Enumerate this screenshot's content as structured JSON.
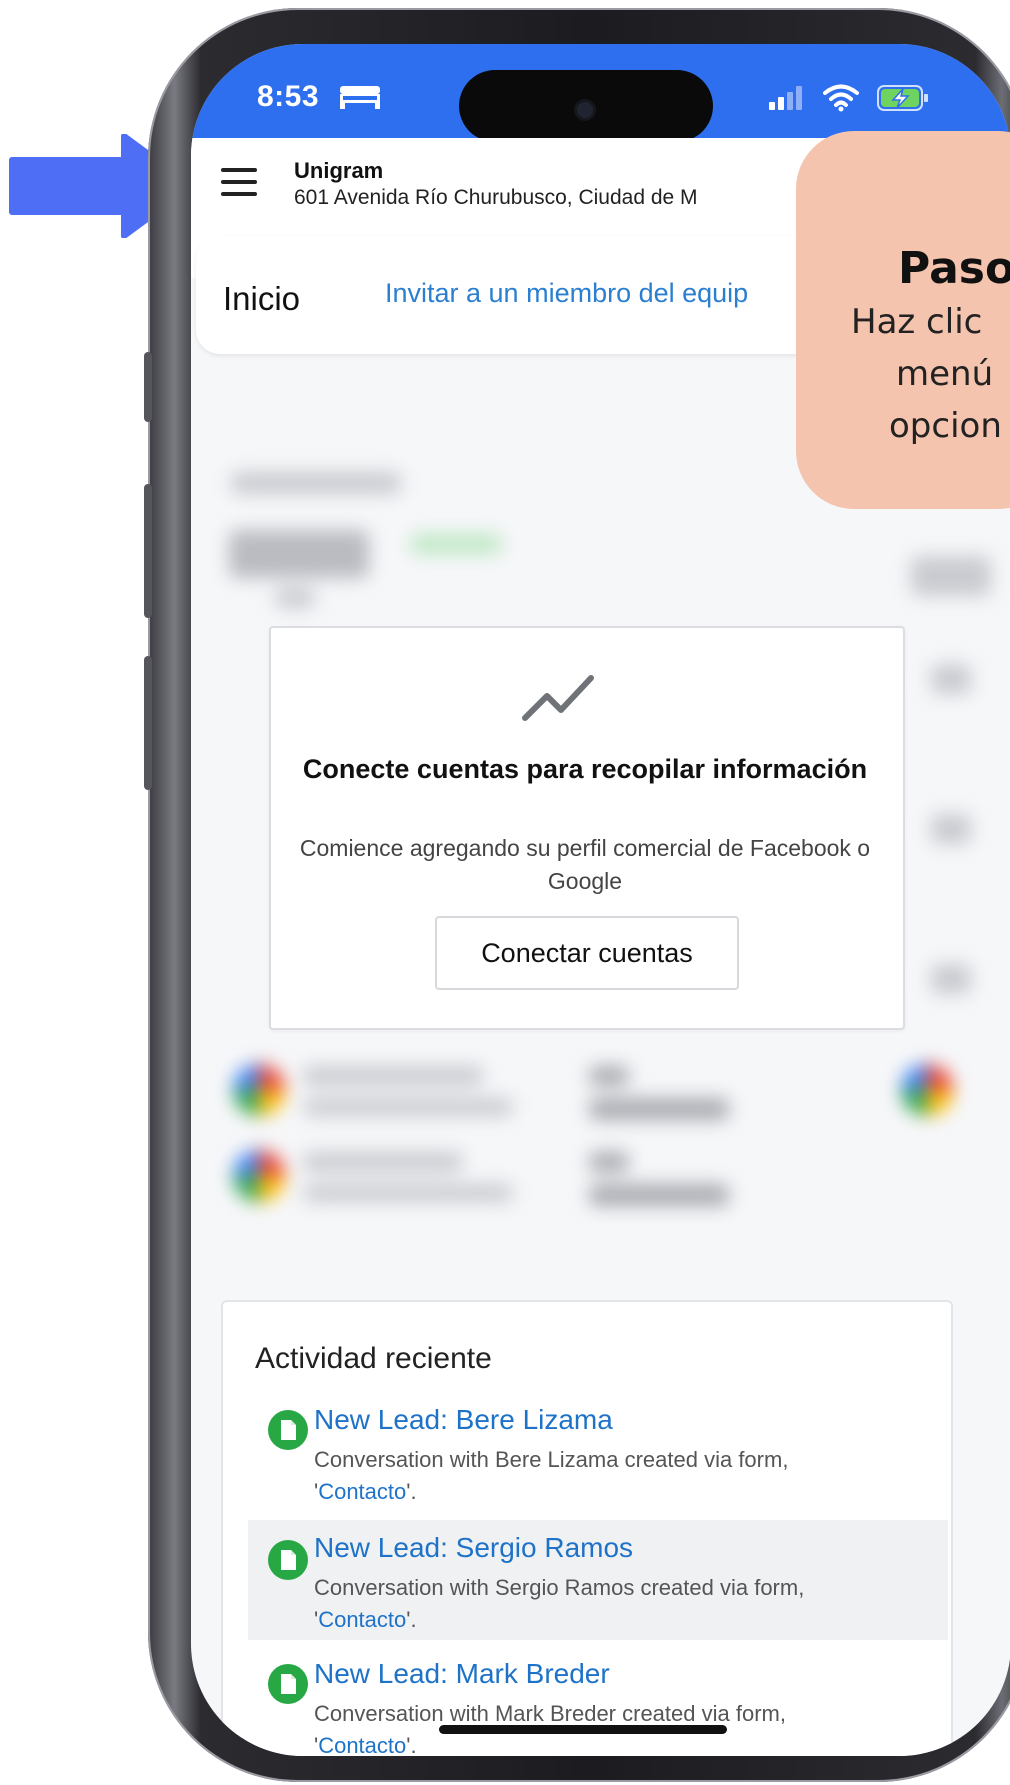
{
  "status_bar": {
    "time": "8:53",
    "background": "#2e6ff0"
  },
  "header": {
    "business_name": "Unigram",
    "address": "601 Avenida Río Churubusco, Ciudad de M"
  },
  "tabs": {
    "home": "Inicio",
    "invite": "Invitar a un miembro del equip"
  },
  "connect_card": {
    "title": "Conecte cuentas para recopilar información",
    "subtitle": "Comience agregando su perfil comercial de Facebook o Google",
    "button": "Conectar cuentas"
  },
  "activity": {
    "title": "Actividad reciente",
    "items": [
      {
        "title": "New Lead: Bere Lizama",
        "desc_before": "Conversation with Bere Lizama created via form, '",
        "link": "Contacto",
        "desc_after": "'."
      },
      {
        "title": "New Lead: Sergio Ramos",
        "desc_before": "Conversation with Sergio Ramos created via form, '",
        "link": "Contacto",
        "desc_after": "'."
      },
      {
        "title": "New Lead: Mark Breder",
        "desc_before": "Conversation with Mark Breder created via form, '",
        "link": "Contacto",
        "desc_after": "'."
      }
    ]
  },
  "tooltip": {
    "title": "Paso",
    "lines": [
      "Haz clic",
      "menú",
      "opcion"
    ],
    "color": "#f4c4ae"
  },
  "colors": {
    "arrow": "#4d6ef5",
    "link": "#1e73c8",
    "lead_icon": "#27a845"
  }
}
